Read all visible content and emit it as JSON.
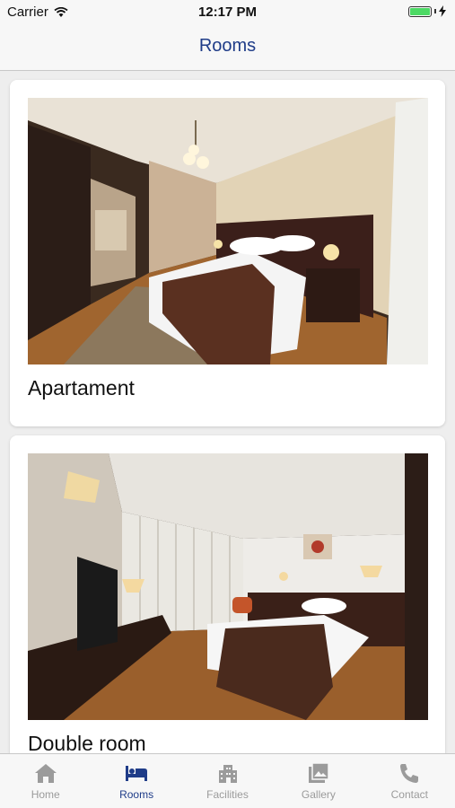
{
  "status_bar": {
    "carrier": "Carrier",
    "time": "12:17 PM"
  },
  "nav": {
    "title": "Rooms"
  },
  "rooms": [
    {
      "name": "Apartament"
    },
    {
      "name": "Double room"
    }
  ],
  "tabs": [
    {
      "label": "Home",
      "icon": "home-icon",
      "active": false
    },
    {
      "label": "Rooms",
      "icon": "bed-icon",
      "active": true
    },
    {
      "label": "Facilities",
      "icon": "building-icon",
      "active": false
    },
    {
      "label": "Gallery",
      "icon": "image-icon",
      "active": false
    },
    {
      "label": "Contact",
      "icon": "phone-icon",
      "active": false
    }
  ],
  "colors": {
    "accent": "#1f3c88",
    "inactive": "#9b9b9b",
    "battery": "#4cd964"
  }
}
